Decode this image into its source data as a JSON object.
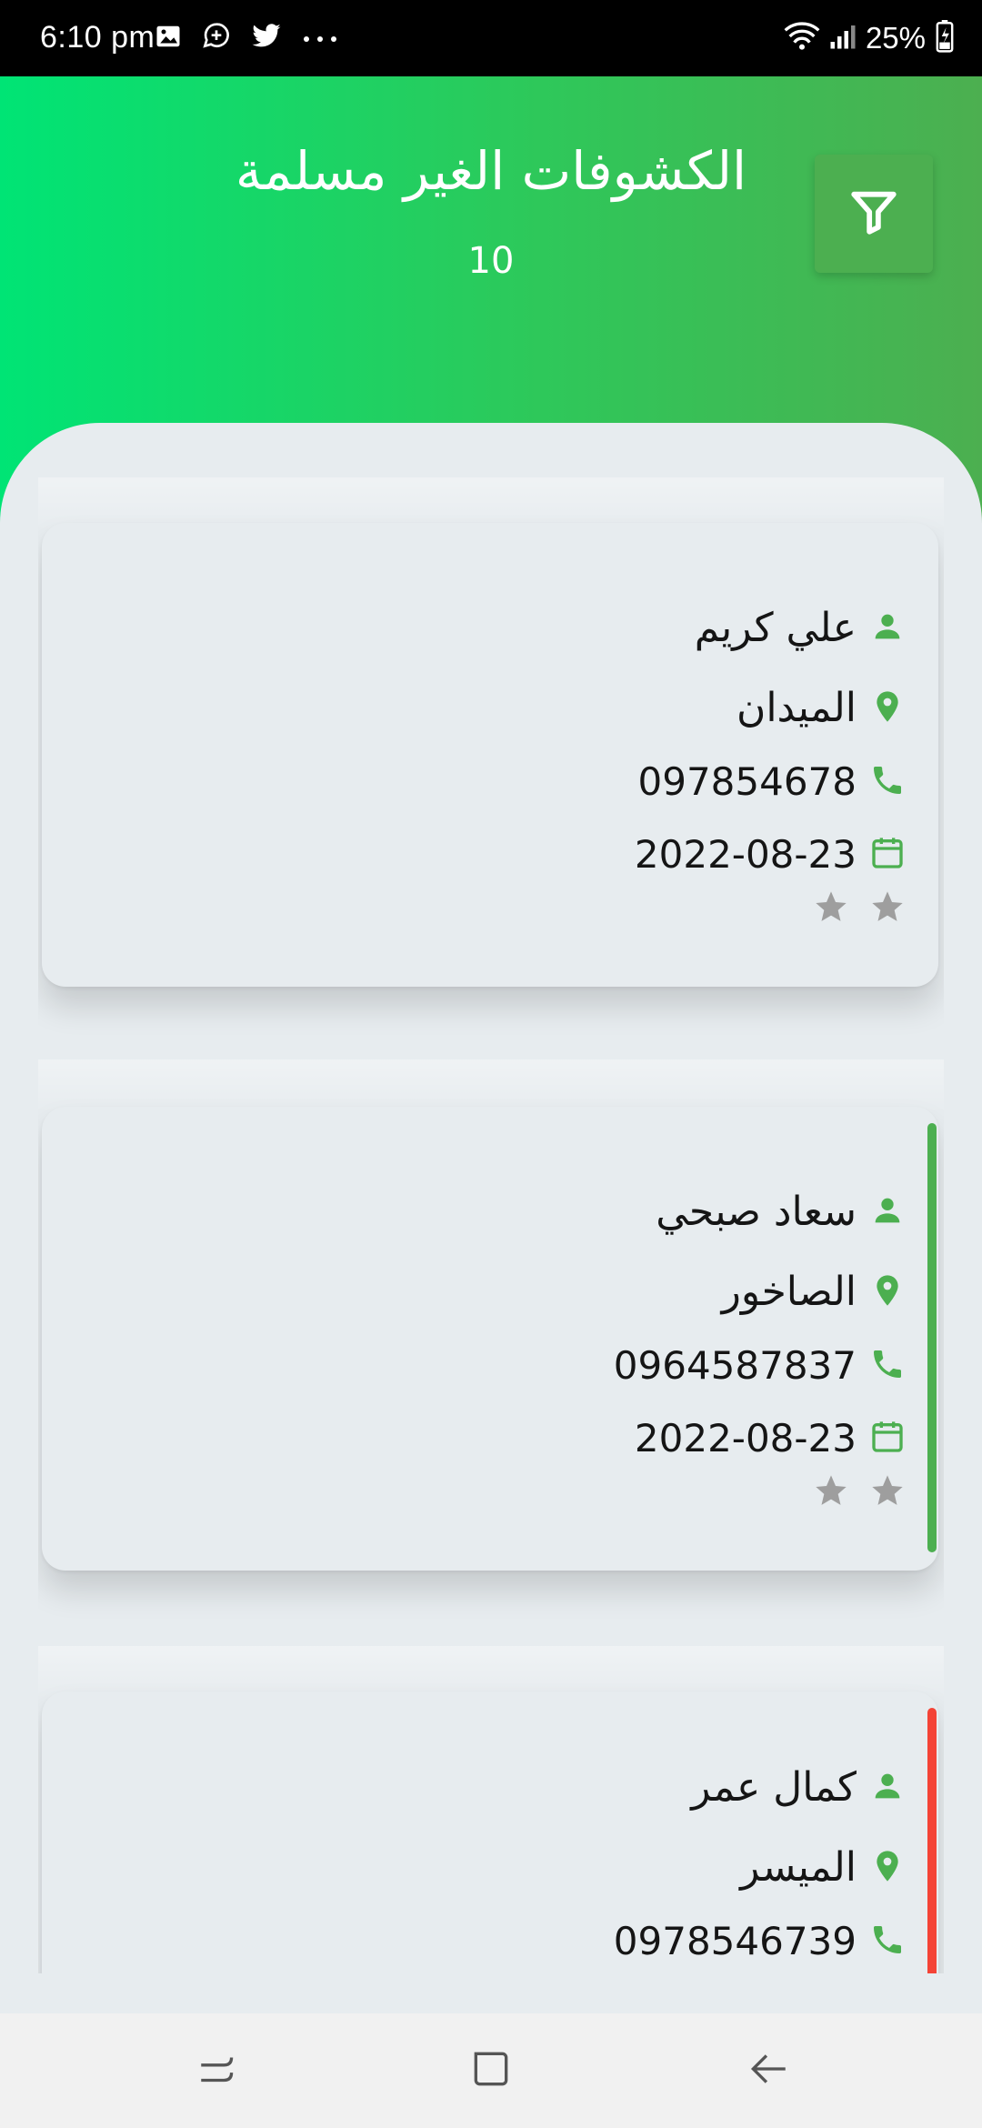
{
  "status_bar": {
    "time": "6:10 pm",
    "battery": "25%",
    "left_icons": [
      "gallery-icon",
      "chat-plus-icon",
      "twitter-icon",
      "more-dots-icon"
    ],
    "right_icons": [
      "wifi-icon",
      "signal-icon",
      "battery-charging-icon"
    ]
  },
  "header": {
    "title": "الكشوفات الغير مسلمة",
    "count": "10",
    "filter_icon": "filter-icon"
  },
  "colors": {
    "gradient_start": "#00e475",
    "gradient_end": "#4caf50",
    "accent_green": "#4caf50",
    "stripe_red": "#f44336",
    "star_gray": "#9e9e9e",
    "background": "#e7ecef"
  },
  "cards": [
    {
      "name": "علي كريم",
      "location": "الميدان",
      "phone": "097854678",
      "date": "2022-08-23",
      "rating": 2,
      "stripe": "none"
    },
    {
      "name": "سعاد صبحي",
      "location": "الصاخور",
      "phone": "0964587837",
      "date": "2022-08-23",
      "rating": 2,
      "stripe": "green"
    },
    {
      "name": "كمال عمر",
      "location": "الميسر",
      "phone": "0978546739",
      "date": "",
      "rating": 0,
      "stripe": "red"
    }
  ],
  "nav": {
    "items": [
      "recent-apps-icon",
      "home-icon",
      "back-icon"
    ]
  }
}
